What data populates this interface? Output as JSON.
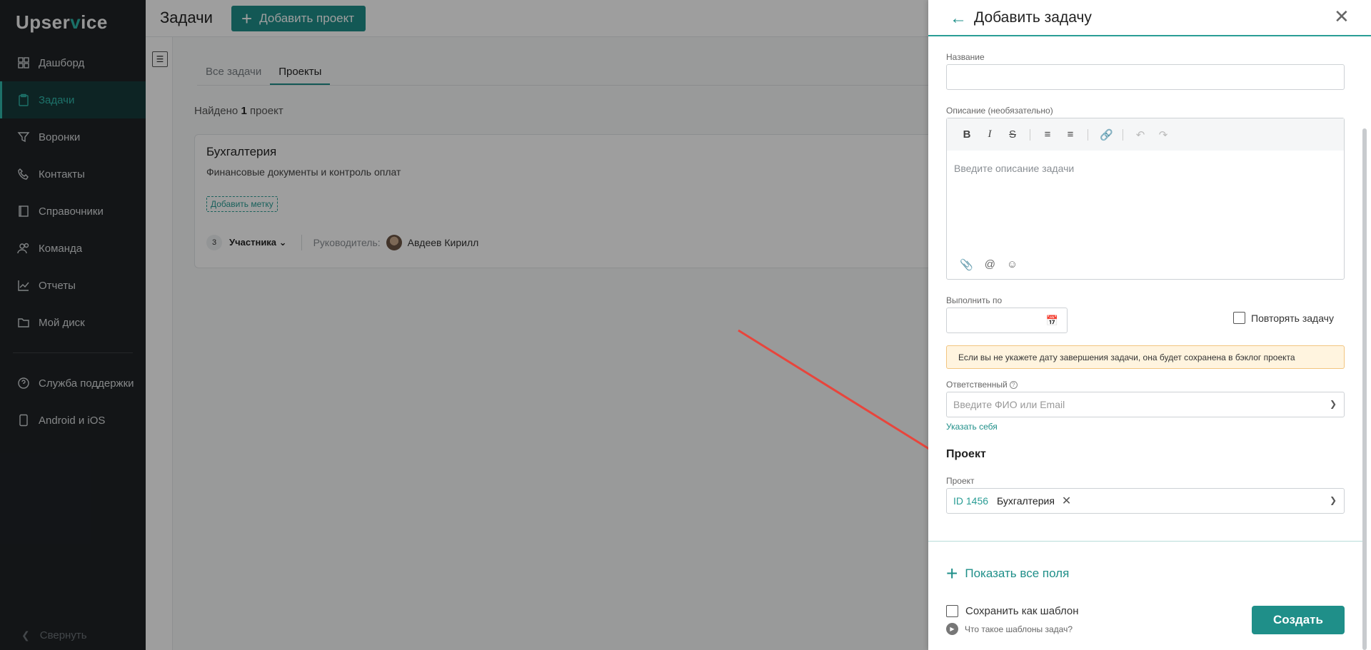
{
  "app": {
    "logo_prefix": "Upser",
    "logo_accent": "v",
    "logo_suffix": "ice"
  },
  "sidebar": {
    "items": [
      {
        "label": "Дашборд",
        "icon": "grid-icon"
      },
      {
        "label": "Задачи",
        "icon": "clipboard-icon",
        "active": true
      },
      {
        "label": "Воронки",
        "icon": "funnel-icon"
      },
      {
        "label": "Контакты",
        "icon": "phone-icon"
      },
      {
        "label": "Справочники",
        "icon": "book-icon"
      },
      {
        "label": "Команда",
        "icon": "users-icon"
      },
      {
        "label": "Отчеты",
        "icon": "chart-icon"
      },
      {
        "label": "Мой диск",
        "icon": "folder-icon"
      }
    ],
    "secondary": [
      {
        "label": "Служба поддержки",
        "icon": "help-circle-icon"
      },
      {
        "label": "Android и iOS",
        "icon": "mobile-icon"
      }
    ],
    "collapse_label": "Свернуть"
  },
  "header": {
    "title": "Задачи",
    "add_project_label": "Добавить проект"
  },
  "tabs": [
    "Все задачи",
    "Проекты"
  ],
  "results": {
    "prefix": "Найдено",
    "count": "1",
    "suffix": "проект"
  },
  "project": {
    "title": "Бухгалтерия",
    "description": "Финансовые документы и контроль оплат",
    "tag_label": "Добавить метку",
    "members_count": "3",
    "members_label": "Участника",
    "manager_label": "Руководитель:",
    "manager_name": "Авдеев Кирилл"
  },
  "panel": {
    "title": "Добавить задачу",
    "name_label": "Название",
    "name_value": "",
    "description_label": "Описание (необязательно)",
    "description_placeholder": "Введите описание задачи",
    "due_label": "Выполнить по",
    "repeat_label": "Повторять задачу",
    "warning": "Если вы не укажете дату завершения задачи, она будет сохранена в бэклог проекта",
    "assignee_label": "Ответственный",
    "assignee_placeholder": "Введите ФИО или Email",
    "assign_self": "Указать себя",
    "project_section": "Проект",
    "project_label": "Проект",
    "project_id": "ID 1456",
    "project_name": "Бухгалтерия",
    "show_all_fields": "Показать все поля",
    "save_template": "Сохранить как шаблон",
    "what_templates": "Что такое шаблоны задач?",
    "create_label": "Создать"
  },
  "colors": {
    "accent": "#1f8f89",
    "sidebar_bg": "#1f2226",
    "warning_bg": "#fff4df",
    "arrow": "#e8453c"
  }
}
